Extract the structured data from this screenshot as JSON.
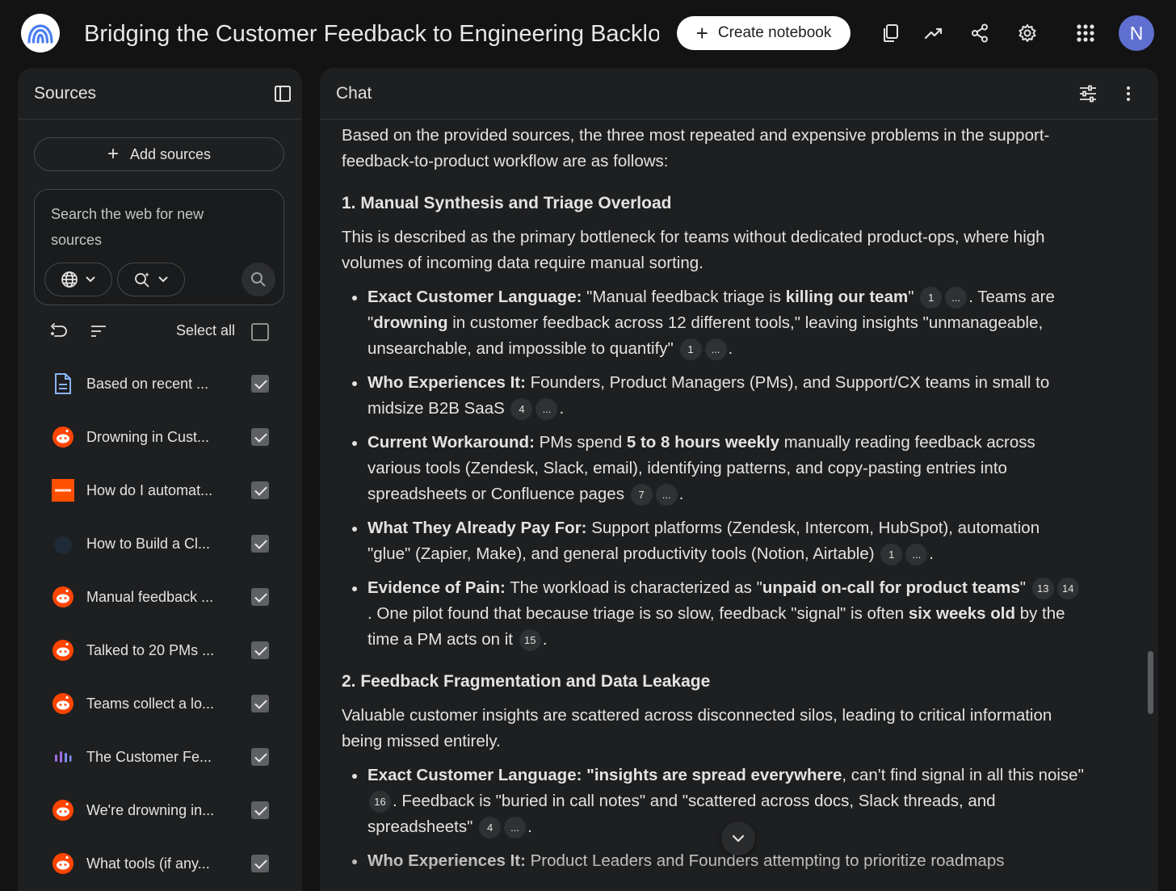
{
  "app": {
    "notebook_title": "Bridging the Customer Feedback to Engineering Backlog",
    "create_label": "Create notebook",
    "avatar_initial": "N",
    "colors": {
      "background": "#131314",
      "panel": "#1e1f20",
      "avatar": "#5f6fd0",
      "reddit": "#ff4500",
      "zapier": "#ff4f00",
      "doc": "#8ab4f8"
    }
  },
  "sources": {
    "title": "Sources",
    "add_label": "Add sources",
    "search_placeholder": "Search the web for new sources",
    "select_all_label": "Select all",
    "items": [
      {
        "label": "Based on recent ...",
        "icon": "document-icon",
        "checked": true
      },
      {
        "label": "Drowning in Cust...",
        "icon": "reddit-icon",
        "checked": true
      },
      {
        "label": "How do I automat...",
        "icon": "zapier-icon",
        "checked": true
      },
      {
        "label": "How to Build a Cl...",
        "icon": "site-icon",
        "checked": true
      },
      {
        "label": "Manual feedback ...",
        "icon": "reddit-icon",
        "checked": true
      },
      {
        "label": "Talked to 20 PMs ...",
        "icon": "reddit-icon",
        "checked": true
      },
      {
        "label": "Teams collect a lo...",
        "icon": "reddit-icon",
        "checked": true
      },
      {
        "label": "The Customer Fe...",
        "icon": "bars-logo-icon",
        "checked": true
      },
      {
        "label": "We're drowning in...",
        "icon": "reddit-icon",
        "checked": true
      },
      {
        "label": "What tools (if any...",
        "icon": "reddit-icon",
        "checked": true
      }
    ]
  },
  "chat": {
    "title": "Chat",
    "intro": "Based on the provided sources, the three most repeated and expensive problems in the support-feedback-to-product workflow are as follows:",
    "s1": {
      "heading": "1. Manual Synthesis and Triage Overload",
      "desc": "This is described as the primary bottleneck for teams without dedicated product-ops, where high volumes of incoming data require manual sorting.",
      "b1": {
        "label": "Exact Customer Language:",
        "t1": " \"Manual feedback triage is ",
        "bold1": "killing our team",
        "t2": "\" ",
        "c1": "1",
        "c2": "...",
        "t3": ". Teams are \"",
        "bold2": "drowning",
        "t4": " in customer feedback across 12 different tools,\" leaving insights \"unmanageable, unsearchable, and impossible to quantify\" ",
        "c3": "1",
        "c4": "...",
        "t5": "."
      },
      "b2": {
        "label": "Who Experiences It:",
        "t1": " Founders, Product Managers (PMs), and Support/CX teams in small to midsize B2B SaaS ",
        "c1": "4",
        "c2": "...",
        "t2": "."
      },
      "b3": {
        "label": "Current Workaround:",
        "t1": " PMs spend ",
        "bold1": "5 to 8 hours weekly",
        "t2": " manually reading feedback across various tools (Zendesk, Slack, email), identifying patterns, and copy-pasting entries into spreadsheets or Confluence pages ",
        "c1": "7",
        "c2": "...",
        "t3": "."
      },
      "b4": {
        "label": "What They Already Pay For:",
        "t1": " Support platforms (Zendesk, Intercom, HubSpot), automation \"glue\" (Zapier, Make), and general productivity tools (Notion, Airtable) ",
        "c1": "1",
        "c2": "...",
        "t2": "."
      },
      "b5": {
        "label": "Evidence of Pain:",
        "t1": " The workload is characterized as \"",
        "bold1": "unpaid on-call for product teams",
        "t2": "\" ",
        "c1": "13",
        "c2": "14",
        "t3": ". One pilot found that because triage is so slow, feedback \"signal\" is often ",
        "bold2": "six weeks old",
        "t4": " by the time a PM acts on it ",
        "c3": "15",
        "t5": "."
      }
    },
    "s2": {
      "heading": "2. Feedback Fragmentation and Data Leakage",
      "desc": "Valuable customer insights are scattered across disconnected silos, leading to critical information being missed entirely.",
      "b1": {
        "label": "Exact Customer Language:",
        "t1": " \"",
        "bold1": "insights are spread everywhere",
        "t2": ", can't find signal in all this noise\" ",
        "c1": "16",
        "t3": ". Feedback is \"buried in call notes\" and \"scattered across docs, Slack threads, and spreadsheets\" ",
        "c2": "4",
        "c3": "...",
        "t4": "."
      },
      "b2": {
        "label": "Who Experiences It:",
        "t1": " Product Leaders and Founders attempting to prioritize roadmaps"
      }
    }
  }
}
